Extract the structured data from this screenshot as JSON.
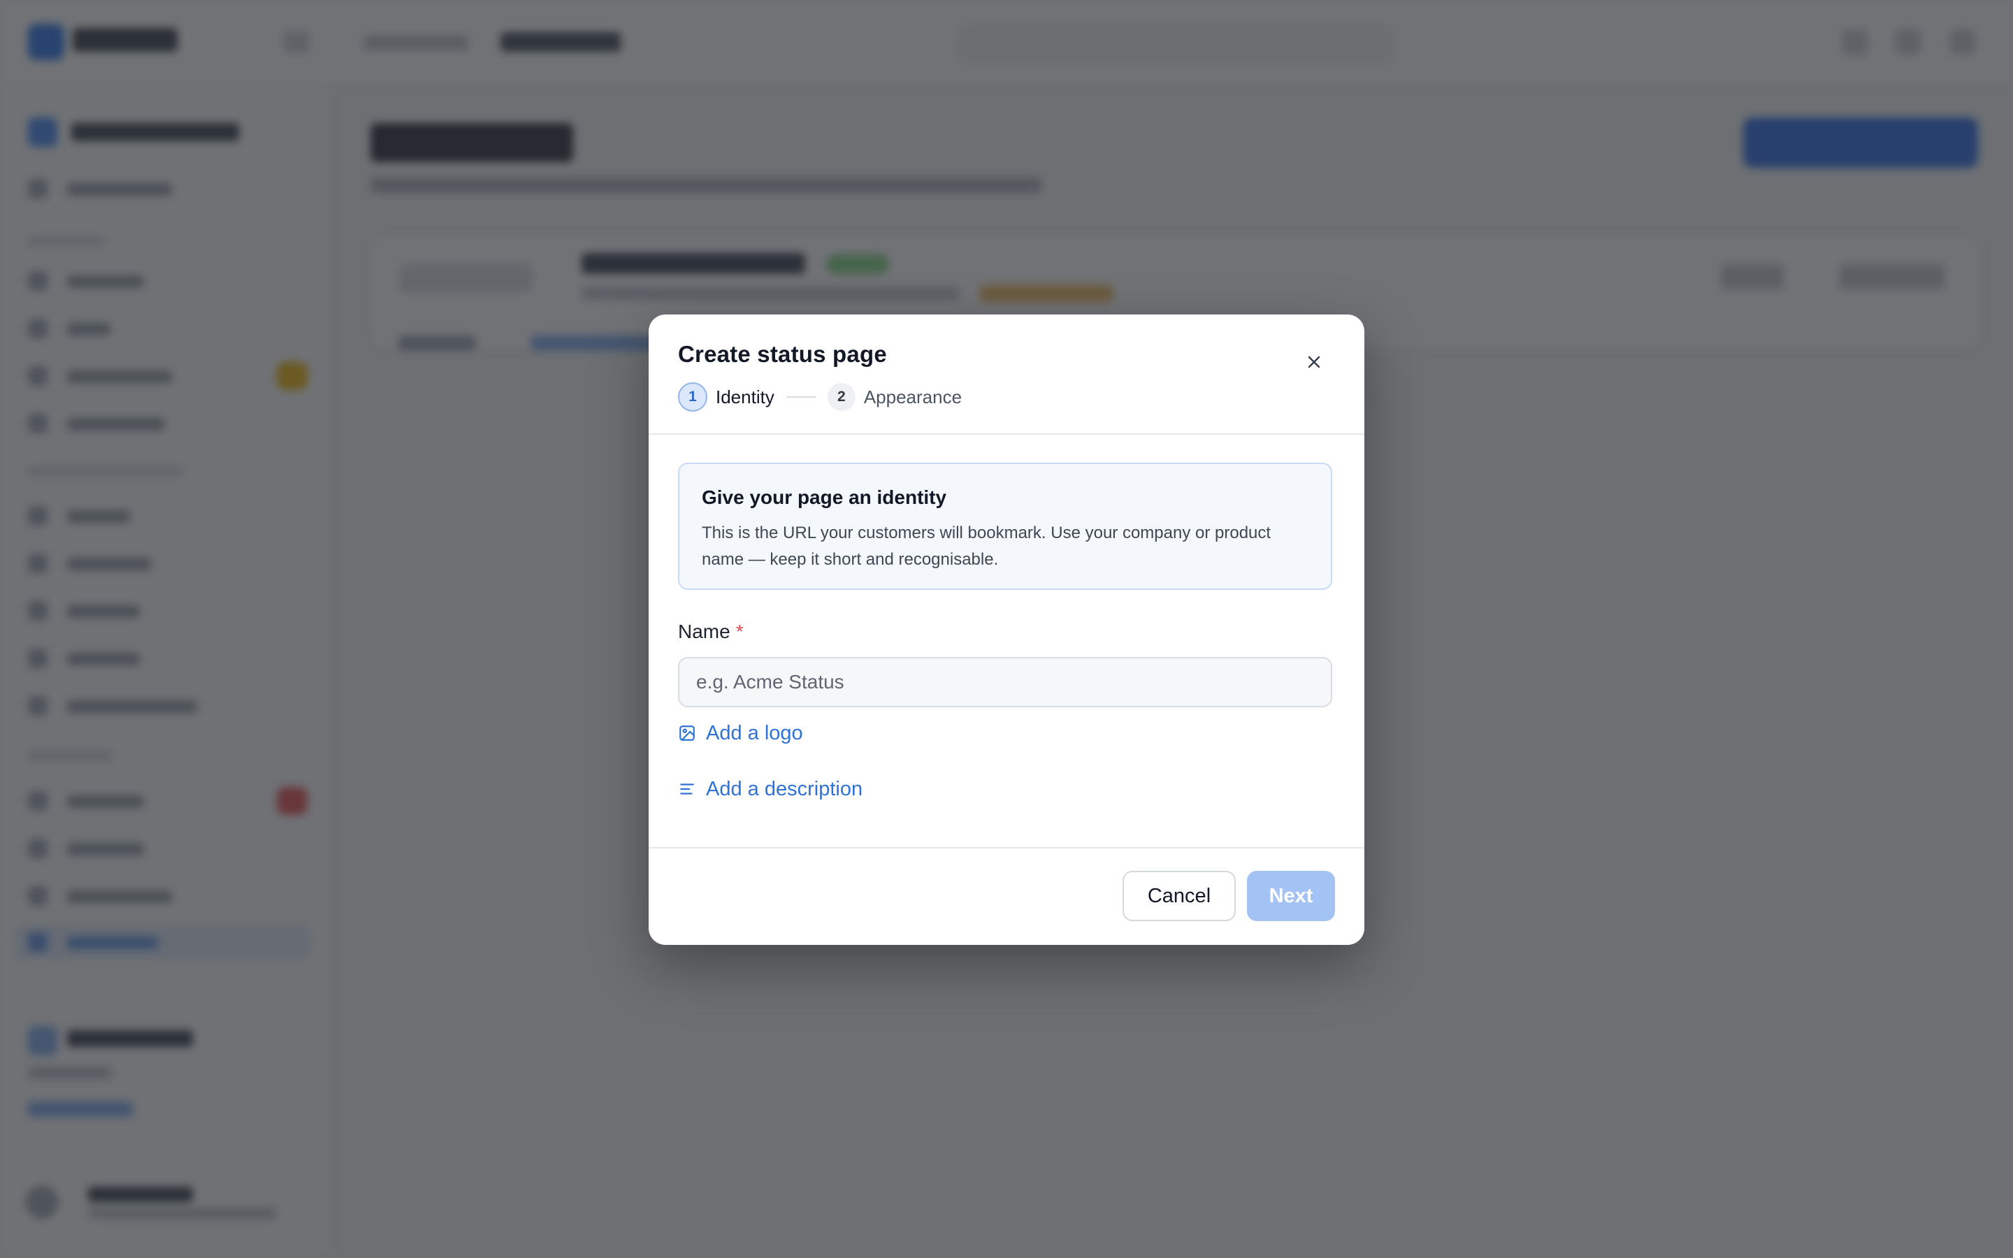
{
  "modal": {
    "title": "Create status page",
    "steps": [
      {
        "number": "1",
        "label": "Identity",
        "state": "active"
      },
      {
        "number": "2",
        "label": "Appearance",
        "state": "upcoming"
      }
    ],
    "info": {
      "title": "Give your page an identity",
      "text": "This is the URL your customers will bookmark. Use your company or product name — keep it short and recognisable."
    },
    "name_field": {
      "label": "Name",
      "required_marker": "*",
      "value": "",
      "placeholder": "e.g. Acme Status"
    },
    "add_logo_label": "Add a logo",
    "add_description_label": "Add a description",
    "cancel_label": "Cancel",
    "next_label": "Next"
  },
  "icons": {
    "close": "close-icon",
    "logo": "image-icon",
    "description": "text-lines-icon"
  },
  "colors": {
    "accent": "#2f72d6",
    "next_disabled": "#a3c3f5",
    "required": "#e5484d",
    "overlay": "rgba(44,47,52,0.68)"
  }
}
